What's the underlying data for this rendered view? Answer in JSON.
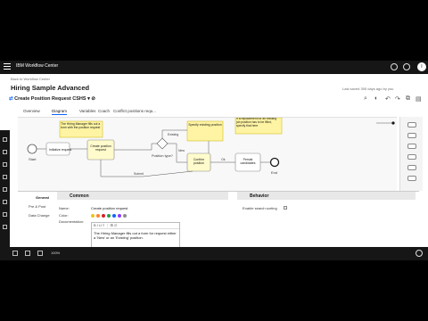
{
  "header": {
    "brand": "IBM Workflow Center",
    "avatar_initial": "I"
  },
  "breadcrumb": "Back to Workflow Center",
  "app_title": "Hiring Sample Advanced",
  "saved_text": "Last saved 395 days ago by you",
  "process": {
    "name": "Create Position Request CSHS"
  },
  "tabs": [
    "Overview",
    "Diagram",
    "Variables",
    "Coach",
    "Conflict positions requ..."
  ],
  "active_tab": "Diagram",
  "diagram": {
    "start_label": "Start",
    "end_label": "End",
    "annotation1": "The Hiring Manager fills out a form with the position request",
    "annotation2": "Specify existing position",
    "annotation3": "If a replacement for an existing job position has to be filled, specify that here",
    "task_initialize": "Initialize request",
    "task_create": "Create position request",
    "gateway": "Position type?",
    "task_confirm": "Confirm position",
    "task_persist": "Persist candidates",
    "flow_new": "New",
    "flow_existing": "Existing",
    "flow_ok": "Ok",
    "flow_submit": "Submit"
  },
  "props": {
    "nav": [
      "General",
      "Pre & Post",
      "Data Change"
    ],
    "section_common": "Common",
    "section_behavior": "Behavior",
    "name_label": "Name:",
    "name_value": "Create position request",
    "color_label": "Color:",
    "doc_label": "Documentation:",
    "doc_text": "The Hiring Manager fills out a form for request either a 'New' or an 'Existing' position.",
    "behavior_label": "Enable search sorting",
    "colors": [
      "#f1c21b",
      "#ff832b",
      "#da1e28",
      "#24a148",
      "#0f62fe",
      "#8a3ffc",
      "#8d8d8d"
    ],
    "rte_tools": "B I U ≡ ⋮ ⊞ ∅"
  },
  "bottom": {
    "zoom": "100%"
  }
}
